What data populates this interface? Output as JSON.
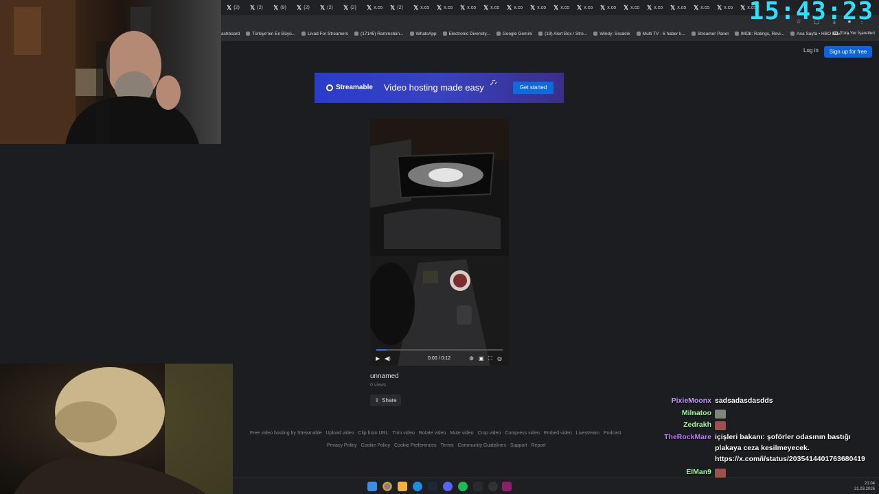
{
  "clock": "15:43:23",
  "tabs": [
    "(2)",
    "(2)",
    "(9)",
    "(2)",
    "(2)",
    "(2)",
    "x.co",
    "(2)",
    "x.co",
    "x.co",
    "x.co",
    "x.co",
    "x.co",
    "x.co",
    "x.co",
    "x.co",
    "x.co",
    "x.co",
    "x.co",
    "x.co",
    "x.co",
    "x.co",
    "x.co"
  ],
  "bookmarks": [
    "ashboard",
    "Türkiye'nin En Büyü...",
    "Livad For Streamers",
    "(17145) Rammstein...",
    "WhatsApp",
    "Electronic Diversity...",
    "Google Gemini",
    "(19) Alert Box / Stre...",
    "Windy: Sıcaklık",
    "Multi TV - 6 haber k...",
    "Streamer Panel",
    "IMDb: Ratings, Revi...",
    "Ana Sayfa • HBO Max"
  ],
  "bookmarks_more": "»",
  "bookmarks_all": "Tüm Yer İşaretleri",
  "header": {
    "login": "Log in",
    "signup": "Sign up for free"
  },
  "banner": {
    "logo": "Streamable",
    "headline": "Video hosting made easy",
    "cta": "Get started"
  },
  "player": {
    "time": "0:00 / 0:12",
    "progress": 0.08
  },
  "video": {
    "title": "unnamed",
    "views": "0 views",
    "share": "Share"
  },
  "footer": {
    "row1": [
      "Free video hosting by Streamable",
      "Upload video",
      "Clip from URL",
      "Trim video",
      "Rotate video",
      "Mute video",
      "Crop video",
      "Compress video",
      "Embed video",
      "Livestream",
      "Podcast"
    ],
    "row2": [
      "Privacy Policy",
      "Cookie Policy",
      "Cookie Preferences",
      "Terms",
      "Community Guidelines",
      "Support",
      "Report"
    ]
  },
  "chat": [
    {
      "user": "PixieMoonx",
      "color": "#c99cff",
      "text": "sadsadasdasdds"
    },
    {
      "user": "Milnatoo",
      "color": "#9dff9d",
      "emote": true
    },
    {
      "user": "Zedrakh",
      "color": "#9dff9d",
      "emote": true
    },
    {
      "user": "TheRockMare",
      "color": "#c37cff",
      "text": "içişleri bakanı: şoförler odasının bastığı",
      "text2": "plakaya ceza kesilmeyecek.",
      "text3": "https://x.com/i/status/2035414401763680419"
    },
    {
      "user": "ElMan9",
      "color": "#9dff9d",
      "emote": true
    },
    {
      "user": "ElMan9",
      "color": "#9dff9d",
      "emote": true
    }
  ],
  "taskbar": {
    "time": "21:04",
    "date": "21.03.2026"
  },
  "colors": {
    "accent": "#0f63d8",
    "clock": "#2de0ff",
    "page_bg": "#1c1d20"
  }
}
